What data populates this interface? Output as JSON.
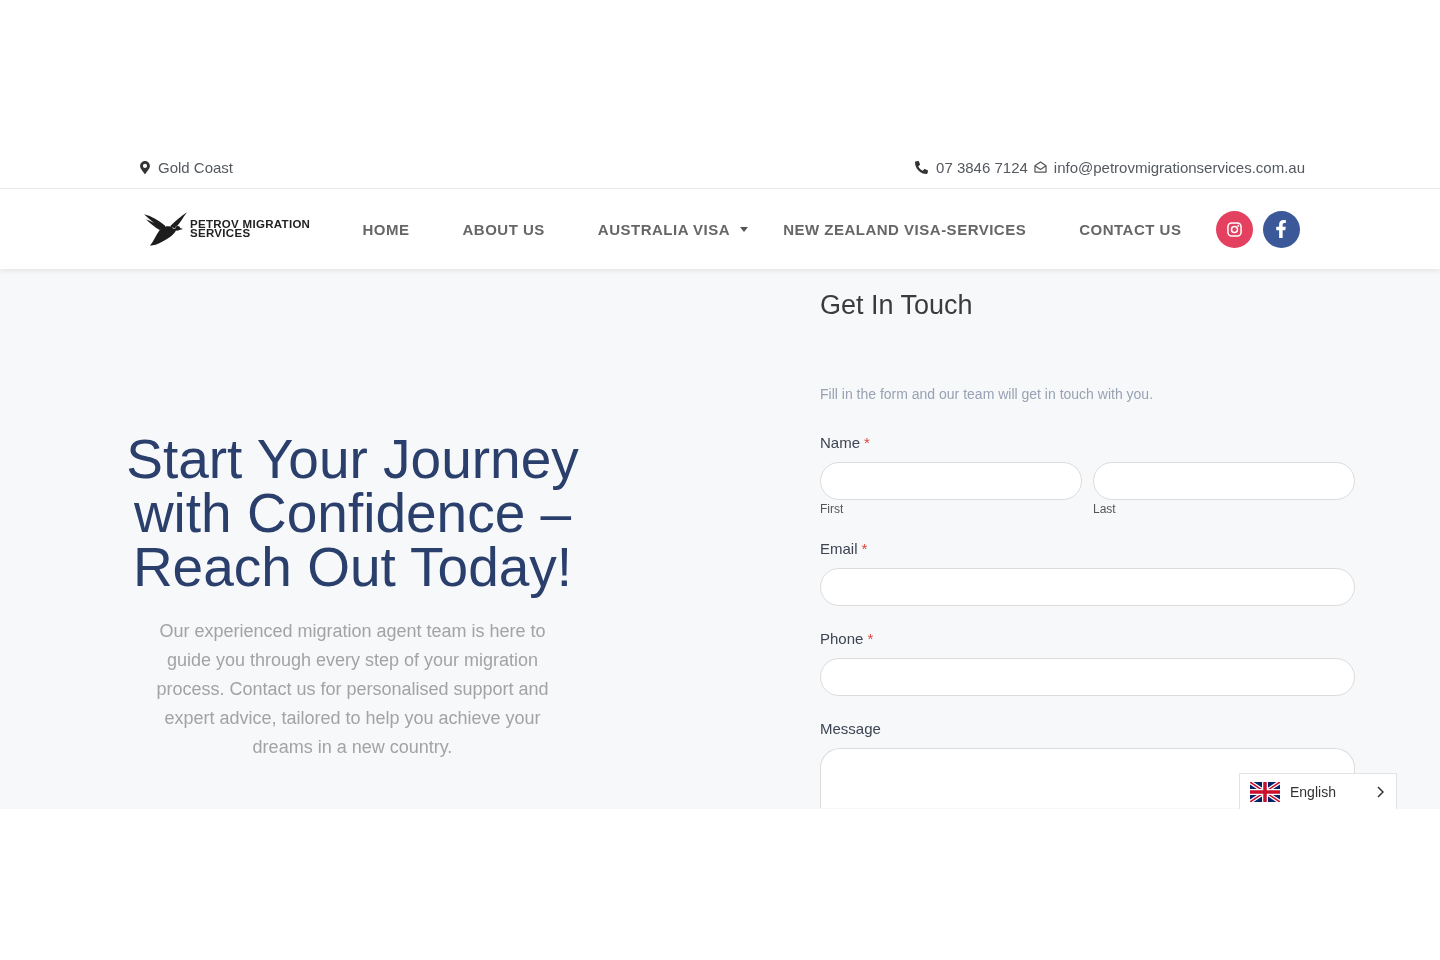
{
  "top_bar": {
    "location": "Gold Coast",
    "phone": "07 3846 7124",
    "email": "info@petrovmigrationservices.com.au"
  },
  "header": {
    "logo": {
      "text": "PETROV MIGRATION SERVICES"
    },
    "nav": [
      {
        "label": "HOME",
        "has_dropdown": false
      },
      {
        "label": "ABOUT US",
        "has_dropdown": false
      },
      {
        "label": "AUSTRALIA VISA",
        "has_dropdown": true
      },
      {
        "label": "NEW ZEALAND VISA-SERVICES",
        "has_dropdown": false
      },
      {
        "label": "CONTACT US",
        "has_dropdown": false
      }
    ],
    "social": [
      {
        "kind": "instagram",
        "color": "#e4405f"
      },
      {
        "kind": "facebook",
        "color": "#3b5998"
      }
    ]
  },
  "hero": {
    "heading": "Start Your Journey with Confidence – Reach Out Today!",
    "text": "Our experienced migration agent team is here to guide you through every step of your migration process. Contact us for personalised support and expert advice, tailored to help you achieve your dreams in a new country."
  },
  "contact_form": {
    "title": "Get In Touch",
    "subtitle": "Fill in the form and our team will get in touch with you.",
    "fields": [
      {
        "kind": "name",
        "label": "Name",
        "required_mark": "*",
        "parts": [
          {
            "sublabel": "First"
          },
          {
            "sublabel": "Last"
          }
        ]
      },
      {
        "kind": "input",
        "label": "Email",
        "required_mark": "*"
      },
      {
        "kind": "input",
        "label": "Phone",
        "required_mark": "*"
      },
      {
        "kind": "textarea",
        "label": "Message"
      }
    ]
  },
  "language_switcher": {
    "label": "English"
  }
}
